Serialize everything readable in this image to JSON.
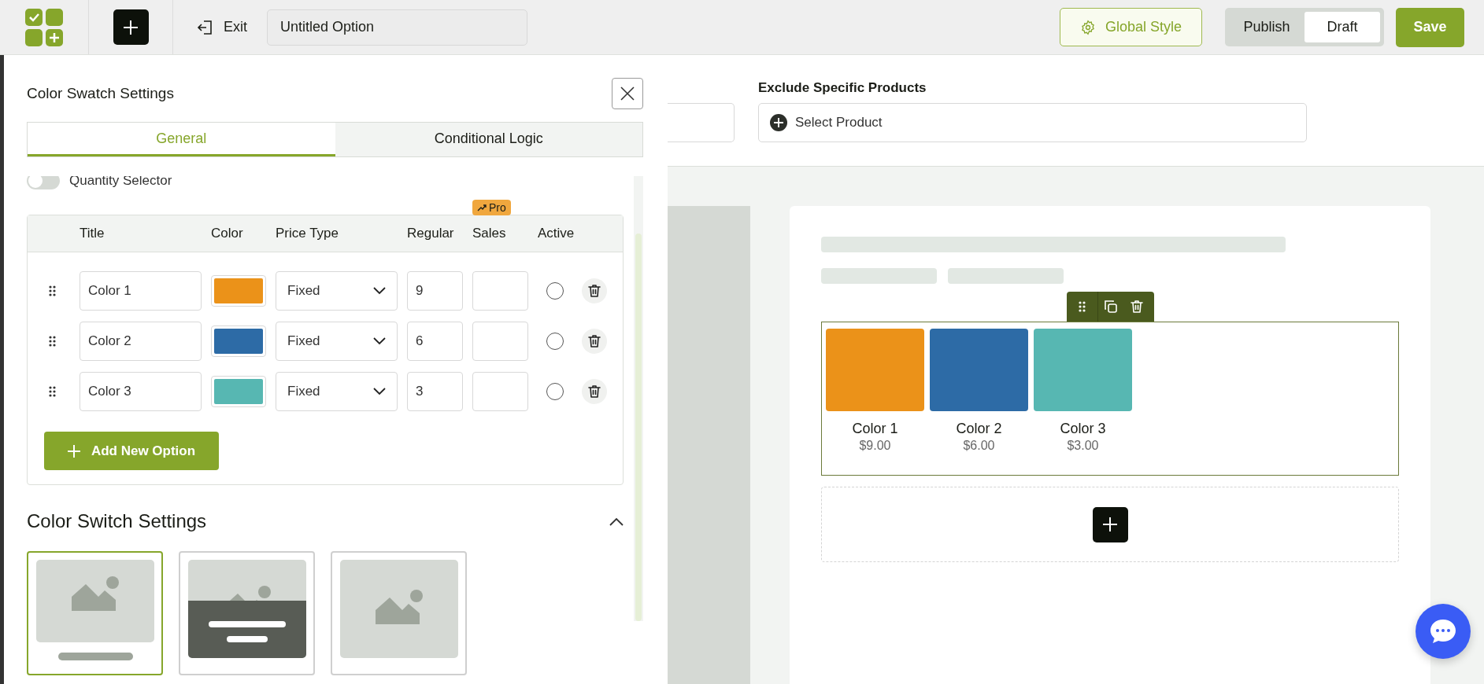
{
  "toolbar": {
    "exit_label": "Exit",
    "option_name": "Untitled Option",
    "global_style": "Global Style",
    "status": [
      {
        "label": "Publish",
        "selected": false
      },
      {
        "label": "Draft",
        "selected": true
      }
    ],
    "save": "Save"
  },
  "panel": {
    "title": "Color Swatch Settings",
    "tabs": [
      {
        "label": "General",
        "selected": true
      },
      {
        "label": "Conditional Logic",
        "selected": false
      }
    ],
    "quantity_selector": {
      "label": "Quantity Selector",
      "on": false
    },
    "table": {
      "columns": [
        "Title",
        "Color",
        "Price Type",
        "Regular",
        "Sales",
        "Active"
      ],
      "pro_badge": "Pro",
      "rows": [
        {
          "title": "Color 1",
          "color": "#eb9219",
          "price_type": "Fixed",
          "regular": "9",
          "active": false
        },
        {
          "title": "Color 2",
          "color": "#2d6ba6",
          "price_type": "Fixed",
          "regular": "6",
          "active": false
        },
        {
          "title": "Color 3",
          "color": "#57b7b2",
          "price_type": "Fixed",
          "regular": "3",
          "active": false
        }
      ]
    },
    "add_button": "Add New Option",
    "section": {
      "title": "Color Switch Settings",
      "expanded": true
    },
    "layouts": [
      {
        "kind": "caption-below",
        "selected": true
      },
      {
        "kind": "overlay",
        "selected": false
      },
      {
        "kind": "image-only",
        "selected": false
      }
    ]
  },
  "preview": {
    "exclude_label": "Exclude Specific Products",
    "exclude_placeholder": "Select Product",
    "swatches": [
      {
        "name": "Color 1",
        "price": "$9.00",
        "color": "#eb9219"
      },
      {
        "name": "Color 2",
        "price": "$6.00",
        "color": "#2d6ba6"
      },
      {
        "name": "Color 3",
        "price": "$3.00",
        "color": "#57b7b2"
      }
    ]
  }
}
